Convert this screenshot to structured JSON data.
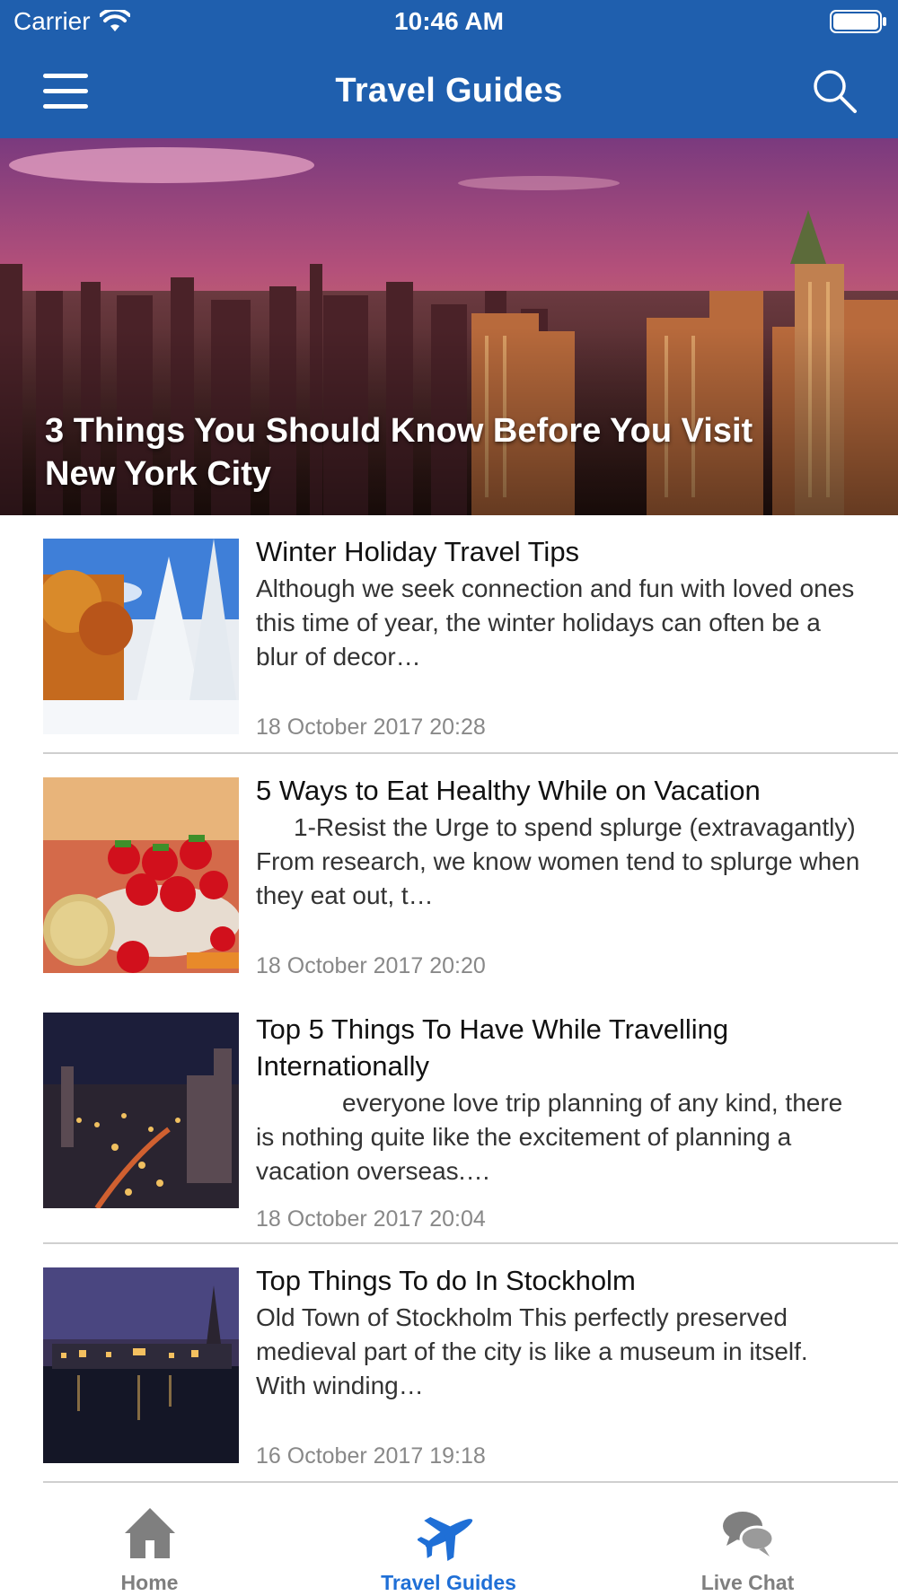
{
  "status_bar": {
    "carrier": "Carrier",
    "time": "10:46 AM"
  },
  "nav": {
    "title": "Travel Guides",
    "menu_icon": "hamburger-menu-icon",
    "search_icon": "search-icon"
  },
  "colors": {
    "header_bg": "#1f5fae",
    "active_tab": "#1f6fd6",
    "inactive_tab": "#7f7f7f",
    "date_text": "#888888"
  },
  "hero": {
    "title": "3 Things You Should Know Before You Visit New York City"
  },
  "articles": [
    {
      "title": "Winter Holiday Travel Tips",
      "excerpt": "Although we seek connection and fun with loved ones this time of year, the winter holidays can often be a blur of decor…",
      "date": "18 October 2017 20:28"
    },
    {
      "title": "5 Ways to Eat Healthy While on Vacation",
      "excerpt": "1-Resist the Urge to spend splurge (extravagantly) From research, we know women tend to splurge when they eat out, t…",
      "date": "18 October 2017 20:20"
    },
    {
      "title": "Top 5 Things  To Have  While Travelling Internationally",
      "excerpt": "everyone love trip planning of any kind, there is nothing quite like the excitement of planning a vacation overseas.…",
      "date": "18 October 2017 20:04"
    },
    {
      "title": "Top Things To do In Stockholm",
      "excerpt": "Old Town of Stockholm This perfectly preserved medieval part of the city is like a museum in itself. With winding…",
      "date": "16 October 2017 19:18"
    }
  ],
  "tabs": [
    {
      "label": "Home",
      "icon": "home-icon",
      "active": false
    },
    {
      "label": "Travel Guides",
      "icon": "airplane-icon",
      "active": true
    },
    {
      "label": "Live Chat",
      "icon": "chat-bubbles-icon",
      "active": false
    }
  ]
}
